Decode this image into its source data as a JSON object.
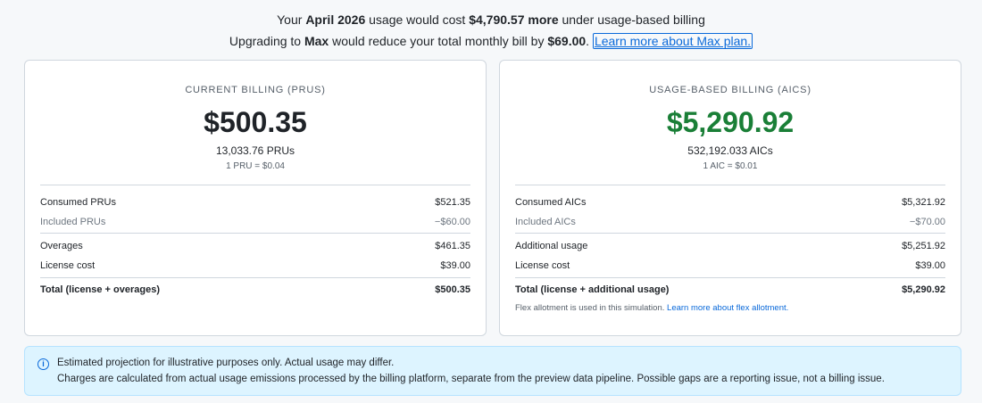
{
  "header": {
    "line1": {
      "prefix": "Your ",
      "month": "April 2026",
      "middle": " usage would cost ",
      "amount": "$4,790.57 more",
      "suffix": " under usage-based billing"
    },
    "line2": {
      "prefix": "Upgrading to ",
      "plan": "Max",
      "middle": " would reduce your total monthly bill by ",
      "amount": "$69.00",
      "suffix": ". ",
      "link_text": "Learn more about Max plan."
    }
  },
  "current_billing": {
    "title": "CURRENT BILLING (PRUS)",
    "amount": "$500.35",
    "units": "13,033.76 PRUs",
    "rate": "1 PRU = $0.04",
    "rows": [
      {
        "label": "Consumed PRUs",
        "value": "$521.35"
      },
      {
        "label": "Included PRUs",
        "value": "−$60.00"
      },
      {
        "label": "Overages",
        "value": "$461.35"
      },
      {
        "label": "License cost",
        "value": "$39.00"
      },
      {
        "label": "Total (license + overages)",
        "value": "$500.35"
      }
    ]
  },
  "usage_billing": {
    "title": "USAGE-BASED BILLING (AICS)",
    "amount": "$5,290.92",
    "units": "532,192.033 AICs",
    "rate": "1 AIC = $0.01",
    "rows": [
      {
        "label": "Consumed AICs",
        "value": "$5,321.92"
      },
      {
        "label": "Included AICs",
        "value": "−$70.00"
      },
      {
        "label": "Additional usage",
        "value": "$5,251.92"
      },
      {
        "label": "License cost",
        "value": "$39.00"
      },
      {
        "label": "Total (license + additional usage)",
        "value": "$5,290.92"
      }
    ],
    "note": "Flex allotment is used in this simulation. ",
    "note_link": "Learn more about flex allotment."
  },
  "banner": {
    "icon": "info-icon",
    "line1": "Estimated projection for illustrative purposes only. Actual usage may differ.",
    "line2": "Charges are calculated from actual usage emissions processed by the billing platform, separate from the preview data pipeline. Possible gaps are a reporting issue, not a billing issue."
  },
  "colors": {
    "accent_link": "#0969da",
    "usage_amount": "#1a7f37",
    "banner_bg": "#ddf4ff"
  }
}
